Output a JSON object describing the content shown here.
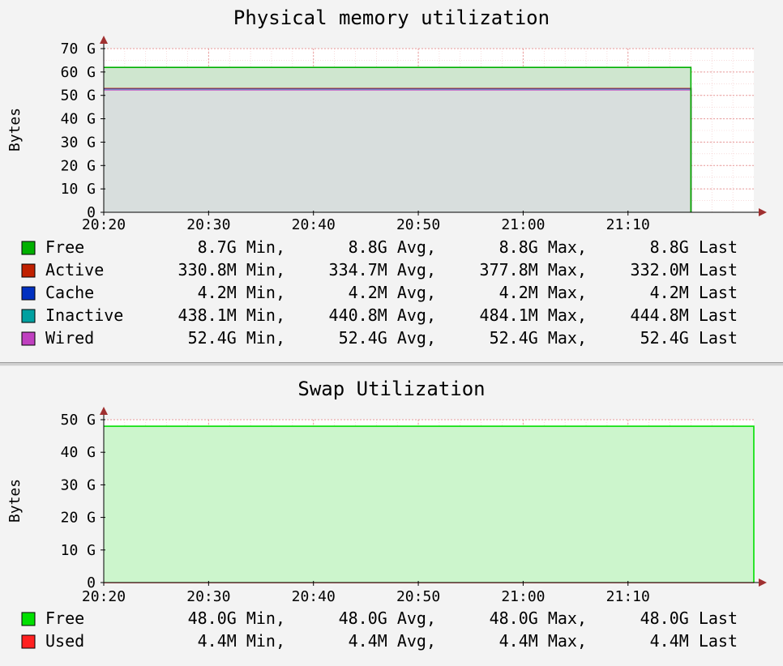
{
  "colors": {
    "grid": "#e89a9a",
    "axis": "#000000",
    "arrow": "#a03030",
    "plot_bg": "#ffffff"
  },
  "chart_data": [
    {
      "type": "area",
      "title": "Physical memory utilization",
      "ylabel": "Bytes",
      "xlabel": "",
      "ylim": [
        0,
        70
      ],
      "yticks": [
        0,
        10,
        20,
        30,
        40,
        50,
        60,
        70
      ],
      "ytick_labels": [
        "0",
        "10 G",
        "20 G",
        "30 G",
        "40 G",
        "50 G",
        "60 G",
        "70 G"
      ],
      "xrange": [
        "20:20",
        "21:22"
      ],
      "xticks": [
        "20:20",
        "20:30",
        "20:40",
        "20:50",
        "21:00",
        "21:10"
      ],
      "x_data_end": "21:16",
      "stacked": true,
      "grid": true,
      "legend_position": "bottom",
      "series": [
        {
          "name": "Wired",
          "color": "#c040c0",
          "fill": "#d8dedd",
          "values_gb": [
            52.4,
            52.4
          ],
          "stats": {
            "min": "52.4G Min,",
            "avg": "52.4G Avg,",
            "max": "52.4G Max,",
            "last": "52.4G Last"
          }
        },
        {
          "name": "Inactive",
          "color": "#00a0a0",
          "fill": "#d8dedd",
          "values_gb": [
            0.44,
            0.44
          ],
          "stats": {
            "min": "438.1M Min,",
            "avg": "440.8M Avg,",
            "max": "484.1M Max,",
            "last": "444.8M Last"
          }
        },
        {
          "name": "Cache",
          "color": "#0030c0",
          "fill": "#d8dedd",
          "values_gb": [
            0.004,
            0.004
          ],
          "stats": {
            "min": "4.2M Min,",
            "avg": "4.2M Avg,",
            "max": "4.2M Max,",
            "last": "4.2M Last"
          }
        },
        {
          "name": "Active",
          "color": "#c02000",
          "fill": "#d8dedd",
          "values_gb": [
            0.33,
            0.33
          ],
          "stats": {
            "min": "330.8M Min,",
            "avg": "334.7M Avg,",
            "max": "377.8M Max,",
            "last": "332.0M Last"
          }
        },
        {
          "name": "Free",
          "color": "#00b000",
          "fill": "#cfe6cf",
          "values_gb": [
            8.8,
            8.8
          ],
          "stats": {
            "min": "8.7G Min,",
            "avg": "8.8G Avg,",
            "max": "8.8G Max,",
            "last": "8.8G Last"
          }
        }
      ],
      "legend_order": [
        "Free",
        "Active",
        "Cache",
        "Inactive",
        "Wired"
      ]
    },
    {
      "type": "area",
      "title": "Swap Utilization",
      "ylabel": "Bytes",
      "xlabel": "",
      "ylim": [
        0,
        50
      ],
      "yticks": [
        0,
        10,
        20,
        30,
        40,
        50
      ],
      "ytick_labels": [
        "0",
        "10 G",
        "20 G",
        "30 G",
        "40 G",
        "50 G"
      ],
      "xrange": [
        "20:20",
        "21:22"
      ],
      "xticks": [
        "20:20",
        "20:30",
        "20:40",
        "20:50",
        "21:00",
        "21:10"
      ],
      "x_data_end": "21:22",
      "stacked": true,
      "grid": true,
      "legend_position": "bottom",
      "series": [
        {
          "name": "Used",
          "color": "#ff2020",
          "fill": "#ff2020",
          "values_gb": [
            0.0044,
            0.0044
          ],
          "stats": {
            "min": "4.4M Min,",
            "avg": "4.4M Avg,",
            "max": "4.4M Max,",
            "last": "4.4M Last"
          }
        },
        {
          "name": "Free",
          "color": "#00e000",
          "fill": "#ccf5cc",
          "values_gb": [
            48.0,
            48.0
          ],
          "stats": {
            "min": "48.0G Min,",
            "avg": "48.0G Avg,",
            "max": "48.0G Max,",
            "last": "48.0G Last"
          }
        }
      ],
      "legend_order": [
        "Free",
        "Used"
      ]
    }
  ]
}
